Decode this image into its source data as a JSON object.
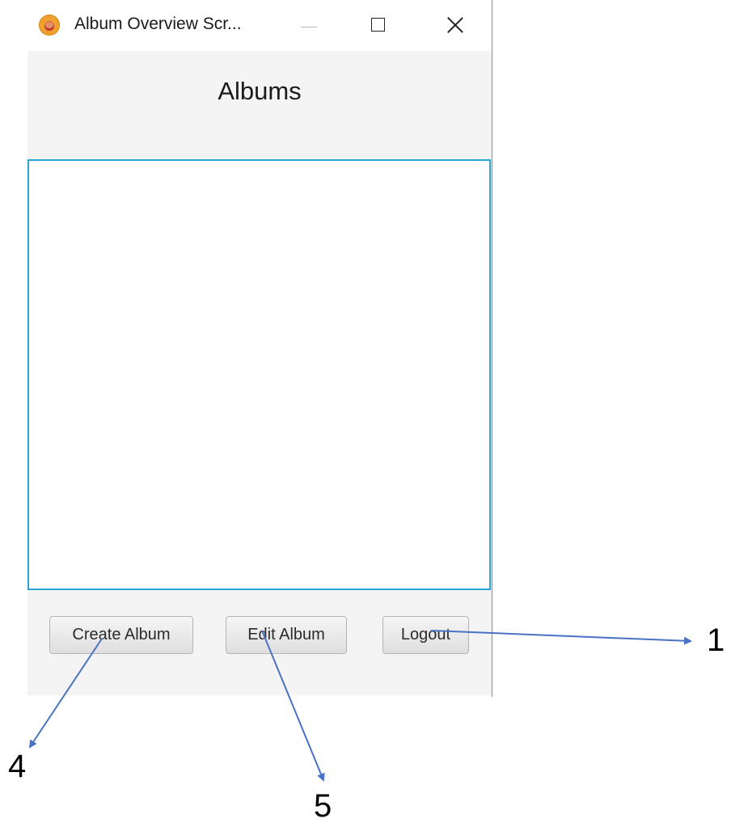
{
  "window": {
    "title": "Album Overview Scr...",
    "icon": "app-logo-icon",
    "controls": [
      "minimize-icon",
      "maximize-icon",
      "close-icon"
    ]
  },
  "header": {
    "title": "Albums"
  },
  "album_list": {
    "items": []
  },
  "actions": {
    "create_label": "Create Album",
    "edit_label": "Edit Album",
    "logout_label": "Logout"
  },
  "annotations": {
    "color": "#4a72c4",
    "labels": [
      "1",
      "4",
      "5"
    ]
  },
  "colors": {
    "list_border": "#2aa3d6",
    "window_background": "#f4f4f4"
  }
}
